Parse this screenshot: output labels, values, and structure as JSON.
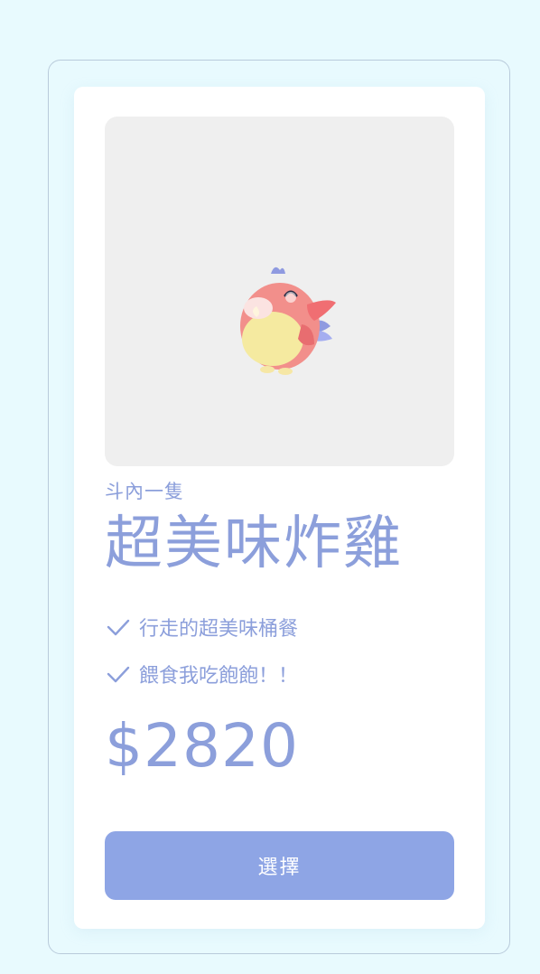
{
  "card": {
    "subtitle": "斗內一隻",
    "title": "超美味炸雞",
    "features": [
      {
        "icon": "check-icon",
        "text": "行走的超美味桶餐"
      },
      {
        "icon": "check-icon",
        "text": "餵食我吃飽飽！！"
      }
    ],
    "price": "$2820",
    "button_label": "選擇",
    "image": {
      "icon": "pink-bird-illustration"
    }
  },
  "colors": {
    "page_background": "#e8fafe",
    "accent_text": "#8c9fdb",
    "button_background": "#8ea5e5",
    "image_background": "#efefef"
  }
}
